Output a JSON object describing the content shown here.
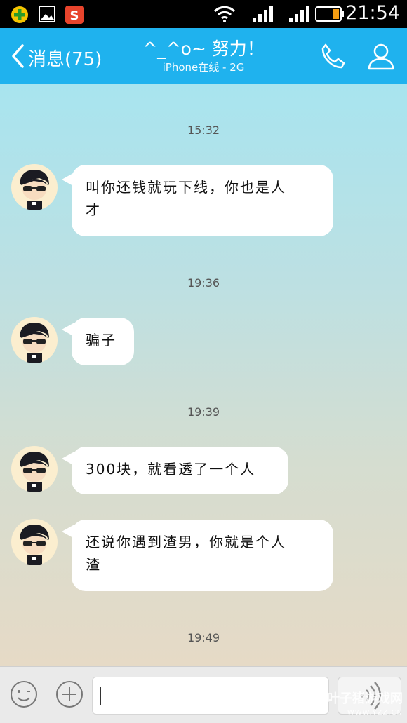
{
  "status_bar": {
    "clock": "21:54",
    "icons": [
      "app-360-icon",
      "image-icon",
      "sogou-s-icon",
      "wifi-icon",
      "signal-icon",
      "signal-icon",
      "battery-icon"
    ]
  },
  "header": {
    "back_label": "消息(75)",
    "title": "^_^o~ 努力！",
    "subtitle": "iPhone在线 - 2G",
    "icons": [
      "back-chevron-icon",
      "phone-icon",
      "person-icon"
    ],
    "background": "#1fb2ee"
  },
  "messages": [
    {
      "time": "15:32",
      "text_lines": [
        "叫你还钱就玩下线，你也是人",
        "才"
      ]
    },
    {
      "time": "19:36",
      "text_lines": [
        "骗子"
      ]
    },
    {
      "time": "19:39",
      "text_lines": [
        "300块，就看透了一个人"
      ]
    },
    {
      "time": "",
      "text_lines": [
        "还说你遇到渣男，你就是个人",
        "渣"
      ]
    }
  ],
  "last_timestamp": "19:49",
  "input_bar": {
    "value": "",
    "icons": [
      "emoji-icon",
      "add-icon",
      "voice-icon"
    ]
  },
  "watermark": {
    "text": "叶子猪游戏网",
    "sub": "WWW.YZZ.CN"
  }
}
